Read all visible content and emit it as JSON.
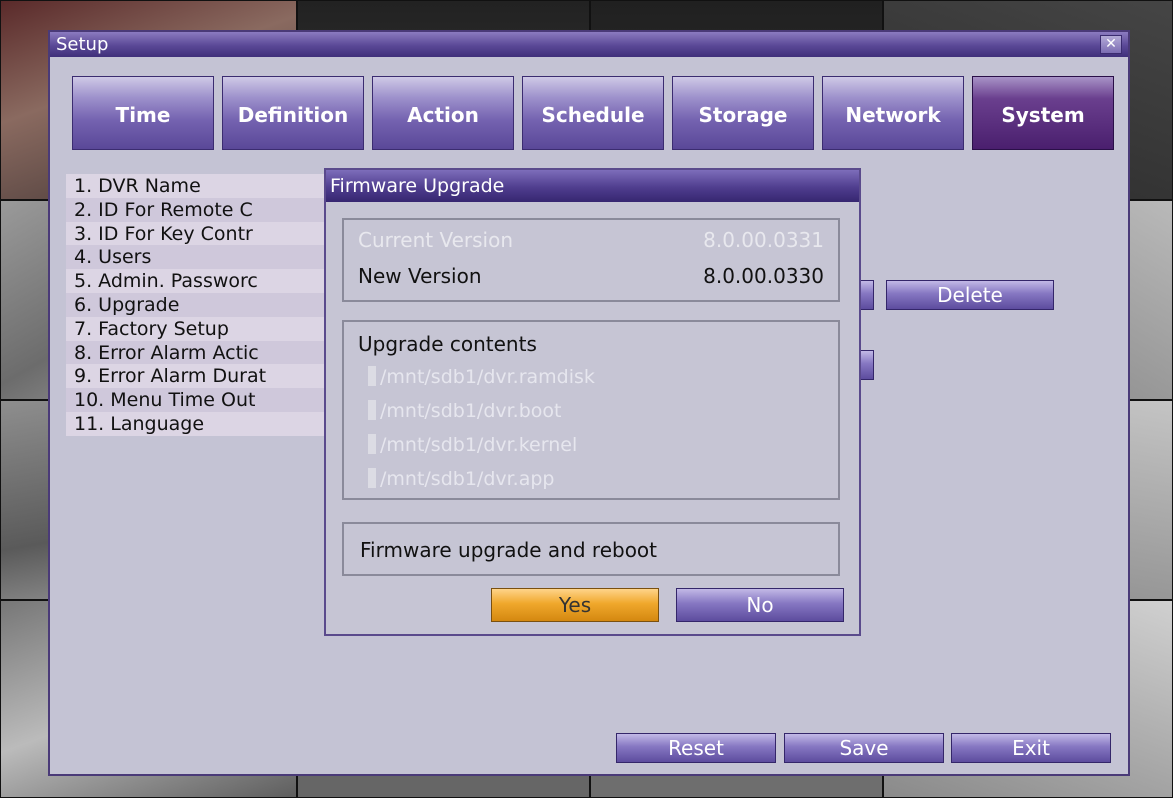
{
  "setup": {
    "title": "Setup",
    "close_glyph": "✕",
    "tabs": [
      {
        "label": "Time"
      },
      {
        "label": "Definition"
      },
      {
        "label": "Action"
      },
      {
        "label": "Schedule"
      },
      {
        "label": "Storage"
      },
      {
        "label": "Network"
      },
      {
        "label": "System",
        "active": true
      }
    ],
    "menu": [
      "1. DVR Name",
      "2. ID For Remote C",
      "3. ID For Key Contr",
      "4. Users",
      "5. Admin. Passworc",
      "6. Upgrade",
      "7. Factory Setup",
      "8. Error Alarm Actic",
      "9. Error Alarm Durat",
      "10. Menu Time Out",
      "11. Language"
    ],
    "delete_label": "Delete",
    "reset_label": "Reset",
    "save_label": "Save",
    "exit_label": "Exit"
  },
  "dialog": {
    "title": "Firmware Upgrade",
    "current_version_label": "Current Version",
    "current_version_value": "8.0.00.0331",
    "new_version_label": "New Version",
    "new_version_value": "8.0.00.0330",
    "contents_title": "Upgrade contents",
    "files": [
      "/mnt/sdb1/dvr.ramdisk",
      "/mnt/sdb1/dvr.boot",
      "/mnt/sdb1/dvr.kernel",
      "/mnt/sdb1/dvr.app"
    ],
    "reboot_text": "Firmware upgrade and reboot",
    "yes_label": "Yes",
    "no_label": "No"
  },
  "colors": {
    "accent": "#5a4896",
    "active_tab": "#4a1f6e",
    "yes_button": "#f0a82c"
  }
}
